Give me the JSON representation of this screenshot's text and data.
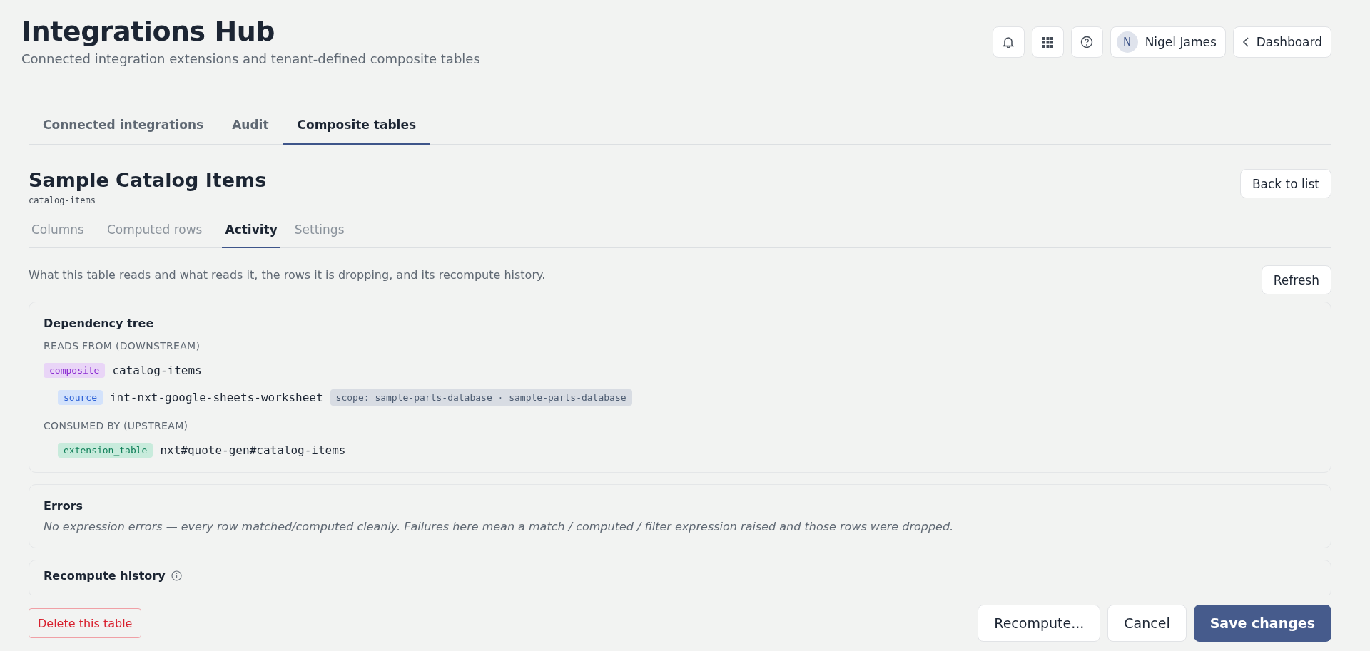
{
  "header": {
    "title": "Integrations Hub",
    "subtitle": "Connected integration extensions and tenant-defined composite tables",
    "user": {
      "initial": "N",
      "name": "Nigel James"
    },
    "back_button": "Dashboard"
  },
  "tabs": [
    {
      "label": "Connected integrations",
      "selected": false
    },
    {
      "label": "Audit",
      "selected": false
    },
    {
      "label": "Composite tables",
      "selected": true
    }
  ],
  "table": {
    "title": "Sample Catalog Items",
    "slug": "catalog-items",
    "back_button": "Back to list"
  },
  "subtabs": [
    {
      "label": "Columns",
      "selected": false
    },
    {
      "label": "Computed rows",
      "selected": false
    },
    {
      "label": "Activity",
      "selected": true
    },
    {
      "label": "Settings",
      "selected": false
    }
  ],
  "activity": {
    "description": "What this table reads and what reads it, the rows it is dropping, and its recompute history.",
    "refresh_button": "Refresh"
  },
  "dependency_tree": {
    "title": "Dependency tree",
    "sections": [
      {
        "heading": "READS FROM (DOWNSTREAM)",
        "nodes": [
          {
            "kind": "composite",
            "name": "catalog-items",
            "children": [
              {
                "kind": "source",
                "name": "int-nxt-google-sheets-worksheet",
                "scope": "scope: sample-parts-database · sample-parts-database"
              }
            ]
          }
        ]
      },
      {
        "heading": "CONSUMED BY (UPSTREAM)",
        "nodes": [
          {
            "kind": "extension_table",
            "name": "nxt#quote-gen#catalog-items",
            "indent": true
          }
        ]
      }
    ]
  },
  "errors": {
    "title": "Errors",
    "message": "No expression errors — every row matched/computed cleanly. Failures here mean a match / computed / filter expression raised and those rows were dropped."
  },
  "recompute_history": {
    "title": "Recompute history"
  },
  "footer": {
    "delete_button": "Delete this table",
    "buttons": [
      {
        "label": "Recompute...",
        "kind": "secondary"
      },
      {
        "label": "Cancel",
        "kind": "secondary"
      },
      {
        "label": "Save changes",
        "kind": "primary"
      }
    ]
  }
}
